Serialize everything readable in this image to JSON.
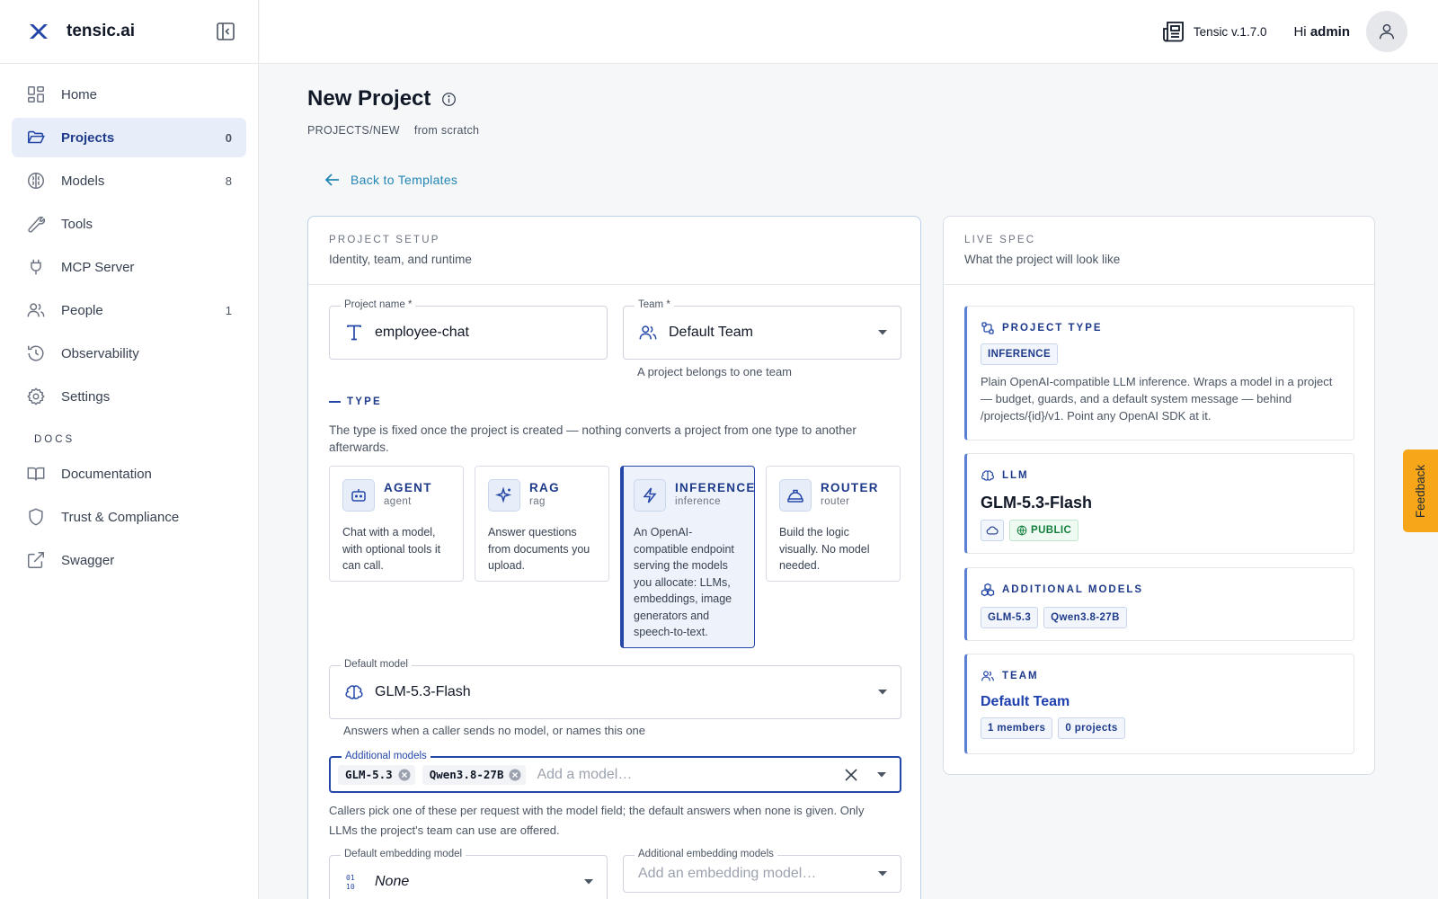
{
  "brand": {
    "name": "tensic.ai"
  },
  "sidebar": {
    "items": [
      {
        "label": "Home",
        "count": ""
      },
      {
        "label": "Projects",
        "count": "0"
      },
      {
        "label": "Models",
        "count": "8"
      },
      {
        "label": "Tools",
        "count": ""
      },
      {
        "label": "MCP Server",
        "count": ""
      },
      {
        "label": "People",
        "count": "1"
      },
      {
        "label": "Observability",
        "count": ""
      },
      {
        "label": "Settings",
        "count": ""
      }
    ],
    "docs_heading": "DOCS",
    "docs": [
      {
        "label": "Documentation"
      },
      {
        "label": "Trust & Compliance"
      },
      {
        "label": "Swagger"
      }
    ]
  },
  "topbar": {
    "version": "Tensic v.1.7.0",
    "greeting": "Hi",
    "user": "admin"
  },
  "page": {
    "title": "New Project",
    "breadcrumb": "PROJECTS/NEW",
    "breadcrumb_sub": "from scratch",
    "back_label": "Back to Templates"
  },
  "setup": {
    "heading": "PROJECT SETUP",
    "subheading": "Identity, team, and runtime",
    "project_name": {
      "label": "Project name *",
      "value": "employee-chat"
    },
    "team": {
      "label": "Team *",
      "value": "Default Team",
      "helper": "A project belongs to one team"
    },
    "type_heading": "TYPE",
    "type_desc": "The type is fixed once the project is created — nothing converts a project from one type to another afterwards.",
    "types": [
      {
        "name": "AGENT",
        "sub": "agent",
        "desc": "Chat with a model, with optional tools it can call."
      },
      {
        "name": "RAG",
        "sub": "rag",
        "desc": "Answer questions from documents you upload."
      },
      {
        "name": "INFERENCE",
        "sub": "inference",
        "desc": "An OpenAI-compatible endpoint serving the models you allocate: LLMs, embeddings, image generators and speech-to-text."
      },
      {
        "name": "ROUTER",
        "sub": "router",
        "desc": "Build the logic visually. No model needed."
      }
    ],
    "default_model": {
      "label": "Default model",
      "value": "GLM-5.3-Flash",
      "helper": "Answers when a caller sends no model, or names this one"
    },
    "additional_models": {
      "label": "Additional models",
      "chips": [
        "GLM-5.3",
        "Qwen3.8-27B"
      ],
      "placeholder": "Add a model…",
      "helper": "Callers pick one of these per request with the model field; the default answers when none is given. Only LLMs the project's team can use are offered."
    },
    "default_embedding": {
      "label": "Default embedding model",
      "value": "None"
    },
    "additional_embedding": {
      "label": "Additional embedding models",
      "placeholder": "Add an embedding model…"
    }
  },
  "spec": {
    "heading": "LIVE SPEC",
    "subheading": "What the project will look like",
    "project_type": {
      "heading": "PROJECT TYPE",
      "tag": "INFERENCE",
      "text": "Plain OpenAI-compatible LLM inference. Wraps a model in a project — budget, guards, and a default system message — behind /projects/{id}/v1. Point any OpenAI SDK at it."
    },
    "llm": {
      "heading": "LLM",
      "name": "GLM-5.3-Flash",
      "visibility": "PUBLIC"
    },
    "additional": {
      "heading": "ADDITIONAL MODELS",
      "tags": [
        "GLM-5.3",
        "Qwen3.8-27B"
      ]
    },
    "team": {
      "heading": "TEAM",
      "name": "Default Team",
      "members": "1 members",
      "projects": "0 projects"
    }
  },
  "feedback": {
    "label": "Feedback"
  },
  "colors": {
    "accent": "#2548a8",
    "link": "#2386b5",
    "feedback": "#f6a618",
    "public": "#15803d"
  }
}
